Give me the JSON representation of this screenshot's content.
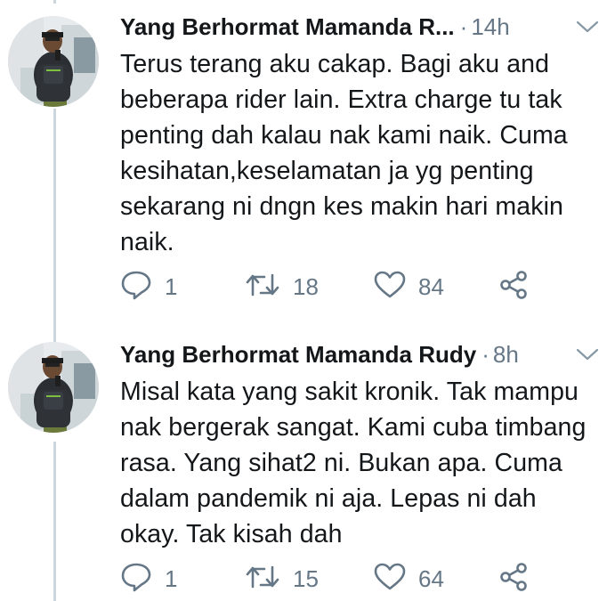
{
  "tweets": [
    {
      "author": "Yang Berhormat Mamanda R...",
      "separator": "·",
      "time": "14h",
      "lines": [
        "Terus terang aku cakap. Bagi aku and",
        "beberapa rider lain. Extra charge tu tak",
        "penting dah kalau nak kami naik. Cuma",
        "kesihatan,keselamatan ja yg penting",
        "sekarang ni dngn kes makin hari makin",
        "naik."
      ],
      "reply_count": "1",
      "retweet_count": "18",
      "like_count": "84"
    },
    {
      "author": "Yang Berhormat Mamanda Rudy",
      "separator": "·",
      "time": "8h",
      "lines": [
        "Misal kata yang sakit kronik. Tak mampu",
        "nak bergerak sangat. Kami cuba timbang",
        "rasa. Yang sihat2 ni. Bukan apa. Cuma",
        "dalam pandemik ni aja. Lepas ni dah",
        "okay. Tak kisah dah"
      ],
      "reply_count": "1",
      "retweet_count": "15",
      "like_count": "64"
    }
  ],
  "icons": {
    "reply": "reply-icon",
    "retweet": "retweet-icon",
    "like": "heart-icon",
    "share": "share-icon",
    "menu": "chevron-down-icon"
  },
  "colors": {
    "text": "#14171a",
    "muted": "#657786",
    "thread_line": "#ccd6dd"
  }
}
